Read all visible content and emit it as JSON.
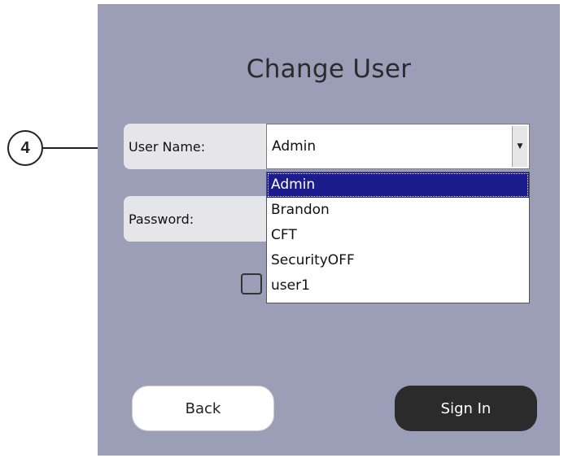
{
  "dialog": {
    "title": "Change User",
    "username_label": "User Name:",
    "username_value": "Admin",
    "password_label": "Password:",
    "password_value": "",
    "back_label": "Back",
    "signin_label": "Sign In",
    "checkbox_checked": false
  },
  "dropdown": {
    "options": [
      "Admin",
      "Brandon",
      "CFT",
      "SecurityOFF",
      "user1"
    ],
    "selected_index": 0
  },
  "callout": {
    "number": "4"
  },
  "colors": {
    "panel_bg": "#9c9db6",
    "selected_bg": "#1c1c8c",
    "signin_bg": "#2b2b2b"
  }
}
